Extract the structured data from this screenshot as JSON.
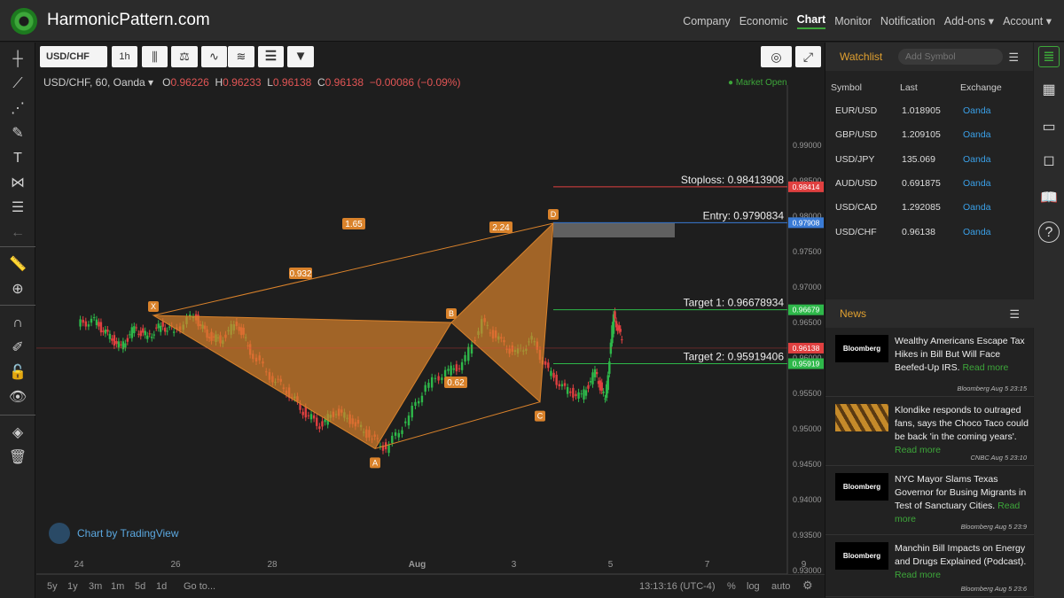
{
  "header": {
    "brand": "HarmonicPattern.com",
    "nav": [
      "Company",
      "Economic",
      "Chart",
      "Monitor",
      "Notification",
      "Add-ons ▾",
      "Account ▾"
    ],
    "active": "Chart"
  },
  "toolbar": {
    "symbol": "USD/CHF",
    "interval": "1h"
  },
  "legend": {
    "title": "USD/CHF, 60, Oanda ▾",
    "o_label": "O",
    "o": "0.96226",
    "h_label": "H",
    "h": "0.96233",
    "l_label": "L",
    "l": "0.96138",
    "c_label": "C",
    "c": "0.96138",
    "change": "−0.00086 (−0.09%)"
  },
  "market_status": "● Market Open",
  "chart_data": {
    "type": "line",
    "pattern_points": [
      {
        "label": "X",
        "x": "Jul 26",
        "y": 0.966
      },
      {
        "label": "A",
        "x": "Aug 1",
        "y": 0.9472
      },
      {
        "label": "B",
        "x": "Aug 3",
        "y": 0.965
      },
      {
        "label": "C",
        "x": "Aug 5",
        "y": 0.9538
      },
      {
        "label": "D",
        "x": "Aug 5",
        "y": 0.979
      }
    ],
    "ratios": [
      "1.65",
      "0.932",
      "2.24",
      "0.62"
    ],
    "levels": [
      {
        "label": "Stoploss: 0.98413908",
        "tag": "0.98414",
        "value": 0.98414,
        "color": "#e04040"
      },
      {
        "label": "Entry: 0.9790834",
        "tag": "0.97908",
        "value": 0.97908,
        "color": "#3a7bd5"
      },
      {
        "label": "Target 1: 0.96678934",
        "tag": "0.96679",
        "value": 0.96679,
        "color": "#2eb84a"
      },
      {
        "label": "Target 2: 0.95919406",
        "tag": "0.95919",
        "value": 0.95919,
        "color": "#2eb84a"
      }
    ],
    "last_price": {
      "tag": "0.96138",
      "value": 0.96138,
      "color": "#e04040"
    },
    "y_ticks": [
      "0.99000",
      "0.98500",
      "0.98000",
      "0.97500",
      "0.97000",
      "0.96500",
      "0.96000",
      "0.95500",
      "0.95000",
      "0.94500",
      "0.94000",
      "0.93500",
      "0.93000"
    ],
    "x_ticks": [
      "24",
      "26",
      "28",
      "Aug",
      "3",
      "5",
      "7",
      "9"
    ],
    "ylim": [
      0.9275,
      0.9925
    ],
    "colors": {
      "up": "#2eb84a",
      "down": "#e04040",
      "pattern_fill": "#d9822b"
    }
  },
  "tradingview": "Chart by TradingView",
  "bottombar": {
    "ranges": [
      "5y",
      "1y",
      "3m",
      "1m",
      "5d",
      "1d"
    ],
    "goto": "Go to...",
    "time": "13:13:16 (UTC-4)",
    "pct": "%",
    "log": "log",
    "auto": "auto"
  },
  "watchlist": {
    "title": "Watchlist",
    "placeholder": "Add Symbol",
    "headers": [
      "Symbol",
      "Last",
      "Exchange"
    ],
    "rows": [
      {
        "symbol": "EUR/USD",
        "last": "1.018905",
        "exchange": "Oanda"
      },
      {
        "symbol": "GBP/USD",
        "last": "1.209105",
        "exchange": "Oanda"
      },
      {
        "symbol": "USD/JPY",
        "last": "135.069",
        "exchange": "Oanda"
      },
      {
        "symbol": "AUD/USD",
        "last": "0.691875",
        "exchange": "Oanda"
      },
      {
        "symbol": "USD/CAD",
        "last": "1.292085",
        "exchange": "Oanda"
      },
      {
        "symbol": "USD/CHF",
        "last": "0.96138",
        "exchange": "Oanda"
      }
    ]
  },
  "news": {
    "title": "News",
    "items": [
      {
        "thumb": "Bloomberg",
        "headline": "Wealthy Americans Escape Tax Hikes in Bill But Will Face Beefed-Up IRS. ",
        "more": "Read more",
        "source": "Bloomberg Aug 5 23:15"
      },
      {
        "thumb": "",
        "headline": "Klondike responds to outraged fans, says the Choco Taco could be back 'in the coming years'. ",
        "more": "Read more",
        "source": "CNBC Aug 5 23:10"
      },
      {
        "thumb": "Bloomberg",
        "headline": "NYC Mayor Slams Texas Governor for Busing Migrants in Test of Sanctuary Cities. ",
        "more": "Read more",
        "source": "Bloomberg Aug 5 23:9"
      },
      {
        "thumb": "Bloomberg",
        "headline": "Manchin Bill Impacts on Energy and Drugs Explained (Podcast). ",
        "more": "Read more",
        "source": "Bloomberg Aug 5 23:6"
      }
    ]
  }
}
